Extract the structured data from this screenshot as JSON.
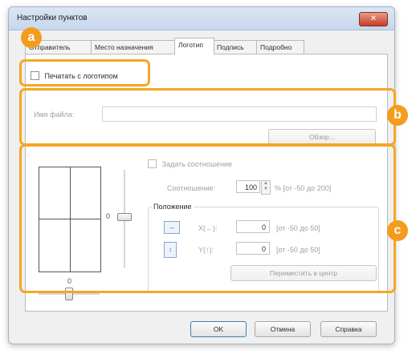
{
  "window": {
    "title": "Настройки пунктов",
    "close_label": "✕"
  },
  "tabs": [
    {
      "label": "Отправитель"
    },
    {
      "label": "Место назначения"
    },
    {
      "label": "Логотип"
    },
    {
      "label": "Подпись"
    },
    {
      "label": "Подробно"
    }
  ],
  "logo": {
    "print_with_logo_label": "Печатать с логотипом",
    "print_with_logo_checked": false
  },
  "file": {
    "label": "Имя файла:",
    "value": "",
    "browse_label": "Обзор..."
  },
  "ratio": {
    "set_ratio_label": "Задать соотношение",
    "ratio_label": "Соотношение:",
    "ratio_value": "100",
    "ratio_range": "% [от -50 до 200]"
  },
  "position": {
    "group_label": "Положение",
    "x_label": "X(←):",
    "x_value": "0",
    "x_range": "[от -50 до 50]",
    "y_label": "Y(↑):",
    "y_value": "0",
    "y_range": "[от -50 до 50]",
    "center_label": "Переместить в центр"
  },
  "preview": {
    "vertical_slider_value": "0",
    "horizontal_slider_value": "0"
  },
  "buttons": {
    "ok": "OK",
    "cancel": "Отмена",
    "help": "Справка"
  },
  "callouts": {
    "a": "a",
    "b": "b",
    "c": "c",
    "color": "#f39c1e"
  }
}
